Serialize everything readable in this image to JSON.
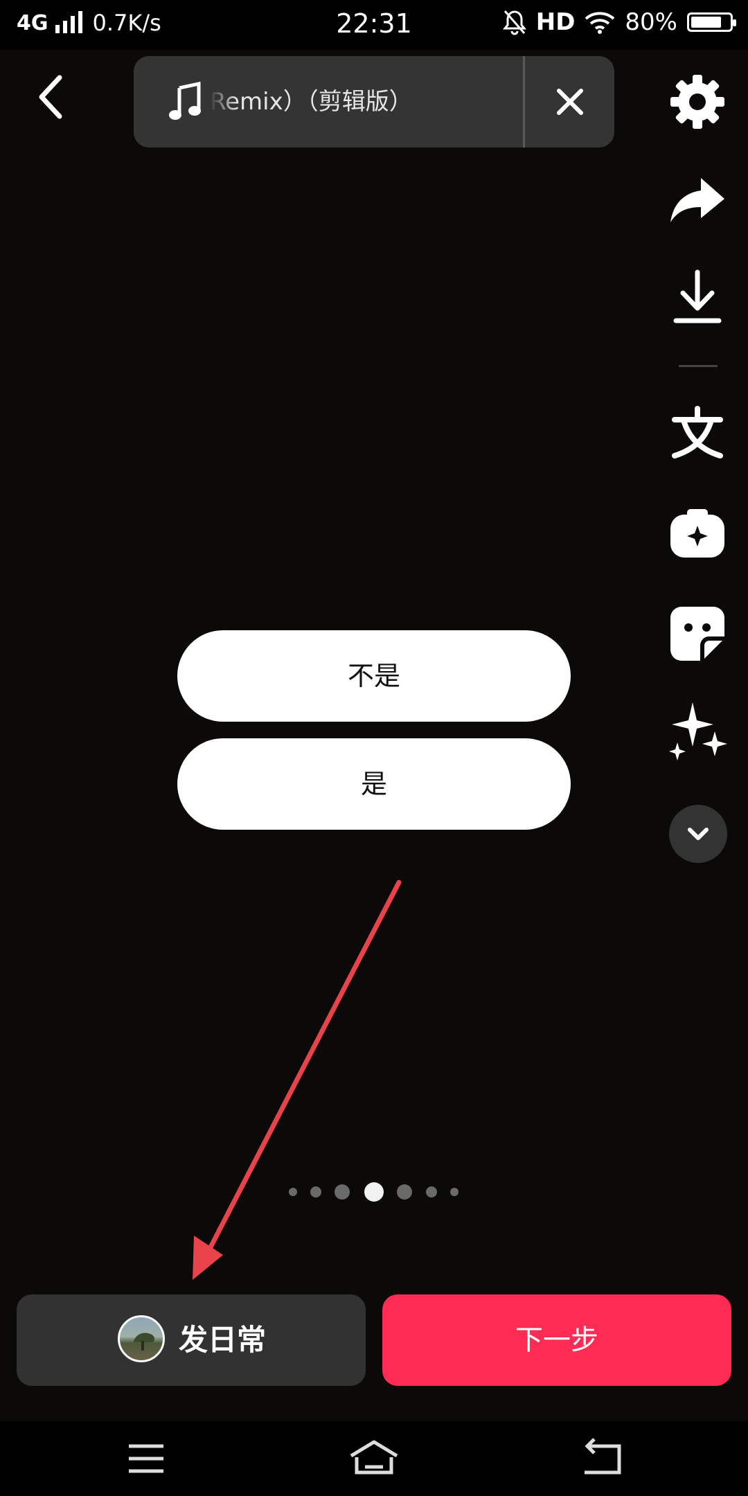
{
  "status_bar": {
    "network": "4G",
    "speed": "0.7K/s",
    "time": "22:31",
    "hd": "HD",
    "battery": "80%",
    "battery_level": 0.8
  },
  "music": {
    "track_title": "Remix）（剪辑版）"
  },
  "side_toolbar": {
    "icons": [
      "gear-icon",
      "share-icon",
      "download-icon",
      "text-icon",
      "camera-plus-icon",
      "sticker-icon",
      "effects-sparkle-icon",
      "chevron-down-icon"
    ]
  },
  "dialog": {
    "option_no": "不是",
    "option_yes": "是"
  },
  "pager": {
    "count": 7,
    "active_index": 3
  },
  "bottom": {
    "daily_label": "发日常",
    "next_label": "下一步"
  },
  "colors": {
    "accent": "#fe2c55",
    "annotation_arrow": "#e8434b",
    "panel": "#323232"
  }
}
